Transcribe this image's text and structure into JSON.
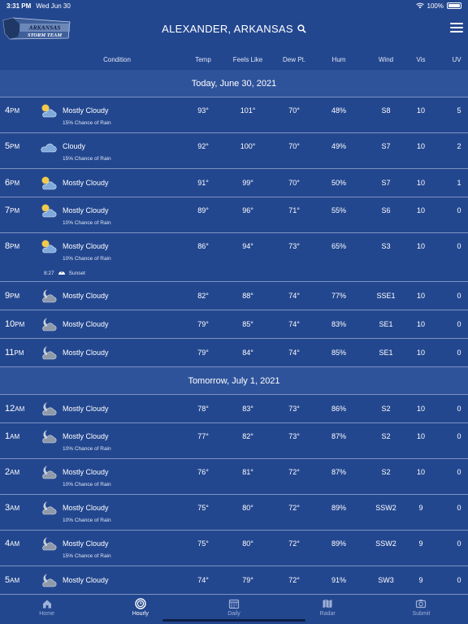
{
  "status": {
    "time": "3:31 PM",
    "date": "Wed Jun 30",
    "battery": "100%"
  },
  "header": {
    "logo_line1": "ARKANSAS",
    "logo_line2": "STORM TEAM",
    "location": "ALEXANDER, ARKANSAS"
  },
  "columns": {
    "condition": "Condition",
    "temp": "Temp",
    "feels": "Feels Like",
    "dew": "Dew Pt.",
    "hum": "Hum",
    "wind": "Wind",
    "vis": "Vis",
    "uv": "UV"
  },
  "days": [
    {
      "title": "Today, June 30, 2021",
      "rows": [
        {
          "hour": "4",
          "ampm": "PM",
          "icon": "partly-cloudy-day-icon",
          "cond": "Mostly Cloudy",
          "chance": "15% Chance of Rain",
          "temp": "93°",
          "feels": "101°",
          "dew": "70°",
          "hum": "48%",
          "wind": "S8",
          "vis": "10",
          "uv": "5"
        },
        {
          "hour": "5",
          "ampm": "PM",
          "icon": "cloudy-icon",
          "cond": "Cloudy",
          "chance": "15% Chance of Rain",
          "temp": "92°",
          "feels": "100°",
          "dew": "70°",
          "hum": "49%",
          "wind": "S7",
          "vis": "10",
          "uv": "2"
        },
        {
          "hour": "6",
          "ampm": "PM",
          "icon": "partly-cloudy-day-icon",
          "cond": "Mostly Cloudy",
          "chance": "",
          "temp": "91°",
          "feels": "99°",
          "dew": "70°",
          "hum": "50%",
          "wind": "S7",
          "vis": "10",
          "uv": "1"
        },
        {
          "hour": "7",
          "ampm": "PM",
          "icon": "partly-cloudy-day-icon",
          "cond": "Mostly Cloudy",
          "chance": "10% Chance of Rain",
          "temp": "89°",
          "feels": "96°",
          "dew": "71°",
          "hum": "55%",
          "wind": "S6",
          "vis": "10",
          "uv": "0"
        },
        {
          "hour": "8",
          "ampm": "PM",
          "icon": "partly-cloudy-day-icon",
          "cond": "Mostly Cloudy",
          "chance": "10% Chance of Rain",
          "temp": "86°",
          "feels": "94°",
          "dew": "73°",
          "hum": "65%",
          "wind": "S3",
          "vis": "10",
          "uv": "0",
          "sunset_time": "8:27",
          "sunset_label": "Sunset"
        },
        {
          "hour": "9",
          "ampm": "PM",
          "icon": "partly-cloudy-night-icon",
          "cond": "Mostly Cloudy",
          "chance": "",
          "temp": "82°",
          "feels": "88°",
          "dew": "74°",
          "hum": "77%",
          "wind": "SSE1",
          "vis": "10",
          "uv": "0"
        },
        {
          "hour": "10",
          "ampm": "PM",
          "icon": "partly-cloudy-night-icon",
          "cond": "Mostly Cloudy",
          "chance": "",
          "temp": "79°",
          "feels": "85°",
          "dew": "74°",
          "hum": "83%",
          "wind": "SE1",
          "vis": "10",
          "uv": "0"
        },
        {
          "hour": "11",
          "ampm": "PM",
          "icon": "partly-cloudy-night-icon",
          "cond": "Mostly Cloudy",
          "chance": "",
          "temp": "79°",
          "feels": "84°",
          "dew": "74°",
          "hum": "85%",
          "wind": "SE1",
          "vis": "10",
          "uv": "0"
        }
      ]
    },
    {
      "title": "Tomorrow, July 1, 2021",
      "rows": [
        {
          "hour": "12",
          "ampm": "AM",
          "icon": "partly-cloudy-night-icon",
          "cond": "Mostly Cloudy",
          "chance": "",
          "temp": "78°",
          "feels": "83°",
          "dew": "73°",
          "hum": "86%",
          "wind": "S2",
          "vis": "10",
          "uv": "0"
        },
        {
          "hour": "1",
          "ampm": "AM",
          "icon": "partly-cloudy-night-icon",
          "cond": "Mostly Cloudy",
          "chance": "10% Chance of Rain",
          "temp": "77°",
          "feels": "82°",
          "dew": "73°",
          "hum": "87%",
          "wind": "S2",
          "vis": "10",
          "uv": "0"
        },
        {
          "hour": "2",
          "ampm": "AM",
          "icon": "partly-cloudy-night-icon",
          "cond": "Mostly Cloudy",
          "chance": "10% Chance of Rain",
          "temp": "76°",
          "feels": "81°",
          "dew": "72°",
          "hum": "87%",
          "wind": "S2",
          "vis": "10",
          "uv": "0"
        },
        {
          "hour": "3",
          "ampm": "AM",
          "icon": "partly-cloudy-night-icon",
          "cond": "Mostly Cloudy",
          "chance": "10% Chance of Rain",
          "temp": "75°",
          "feels": "80°",
          "dew": "72°",
          "hum": "89%",
          "wind": "SSW2",
          "vis": "9",
          "uv": "0"
        },
        {
          "hour": "4",
          "ampm": "AM",
          "icon": "partly-cloudy-night-icon",
          "cond": "Mostly Cloudy",
          "chance": "15% Chance of Rain",
          "temp": "75°",
          "feels": "80°",
          "dew": "72°",
          "hum": "89%",
          "wind": "SSW2",
          "vis": "9",
          "uv": "0"
        },
        {
          "hour": "5",
          "ampm": "AM",
          "icon": "partly-cloudy-night-icon",
          "cond": "Mostly Cloudy",
          "chance": "",
          "temp": "74°",
          "feels": "79°",
          "dew": "72°",
          "hum": "91%",
          "wind": "SW3",
          "vis": "9",
          "uv": "0"
        }
      ]
    }
  ],
  "tabs": [
    {
      "label": "Home",
      "icon": "home-icon",
      "active": false
    },
    {
      "label": "Hourly",
      "icon": "clock-icon",
      "active": true
    },
    {
      "label": "Daily",
      "icon": "calendar-icon",
      "active": false
    },
    {
      "label": "Radar",
      "icon": "map-icon",
      "active": false
    },
    {
      "label": "Submit",
      "icon": "camera-icon",
      "active": false
    }
  ]
}
